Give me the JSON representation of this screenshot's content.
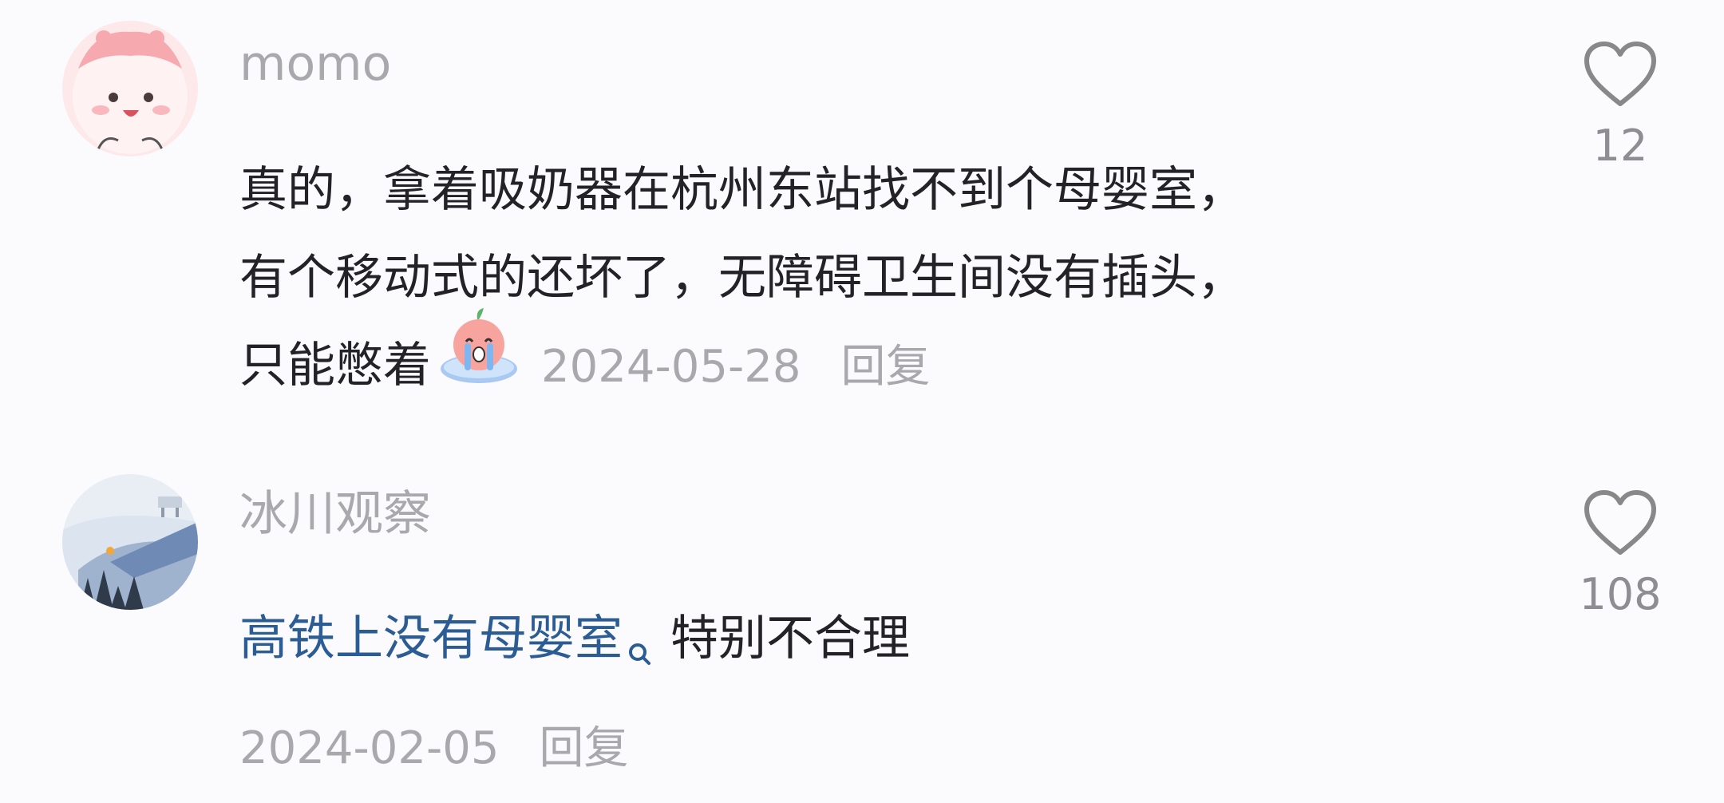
{
  "comments": [
    {
      "username": "momo",
      "lines": [
        "真的，拿着吸奶器在杭州东站找不到个母婴室，",
        "有个移动式的还坏了，无障碍卫生间没有插头，",
        "只能憋着"
      ],
      "emoji_icon": "crying-emoji-icon",
      "date": "2024-05-28",
      "reply_label": "回复",
      "like_count": "12",
      "avatar_icon": "pink-character-avatar"
    },
    {
      "username": "冰川观察",
      "link_text": "高铁上没有母婴室",
      "text_after": "特别不合理",
      "date": "2024-02-05",
      "reply_label": "回复",
      "like_count": "108",
      "avatar_icon": "snowy-landscape-avatar"
    }
  ],
  "colors": {
    "background": "#fbfbfd",
    "username": "#a9a9ad",
    "text": "#222227",
    "link": "#2b5c93",
    "meta": "#a9a9ad"
  }
}
